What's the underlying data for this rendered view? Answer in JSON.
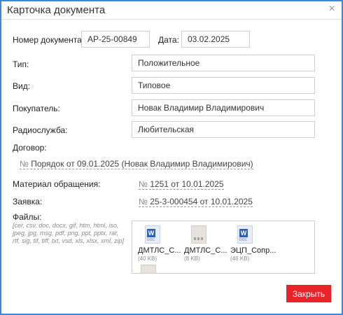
{
  "window": {
    "title": "Карточка документа",
    "close_glyph": "×"
  },
  "form": {
    "doc_number_label": "Номер документа:",
    "doc_number_value": "AP-25-00849",
    "date_label": "Дата:",
    "date_value": "03.02.2025",
    "type_label": "Тип:",
    "type_value": "Положительное",
    "kind_label": "Вид:",
    "kind_value": "Типовое",
    "buyer_label": "Покупатель:",
    "buyer_value": "Новак Владимир Владимирович",
    "radio_label": "Радиослужба:",
    "radio_value": "Любительская",
    "contract_label": "Договор:",
    "contract_num": "№",
    "contract_text": "Порядок от 09.01.2025 (Новак Владимир Владимирович)",
    "material_label": "Материал обращения:",
    "material_num": "№",
    "material_text": "1251 от 10.01.2025",
    "request_label": "Заявка:",
    "request_num": "№",
    "request_text": "25-3-000454 от 10.01.2025",
    "files_label": "Файлы:",
    "files_hint": "[cer, csv, doc, docx, gif, htm, html, iso, jpeg, jpg, msg, pdf, png, ppt, pptx, rar, rtf, sig, tif, tiff, txt, vsd, xls, xlsx, xml, zip]"
  },
  "files": [
    {
      "name": "ДМТЛС_С...",
      "size": "(40 KB)",
      "icon": "word-doc-icon",
      "badge": "W",
      "ext": "DOC"
    },
    {
      "name": "ДМТЛС_С...",
      "size": "(8 KB)",
      "icon": "generic-file-icon"
    },
    {
      "name": "ЭЦП_Сопр...",
      "size": "(46 KB)",
      "icon": "word-doc-icon",
      "badge": "W",
      "ext": "DOC"
    }
  ],
  "footer": {
    "close_label": "Закрыть"
  },
  "colors": {
    "accent": "#3f86d6",
    "close_button": "#e8232a"
  }
}
